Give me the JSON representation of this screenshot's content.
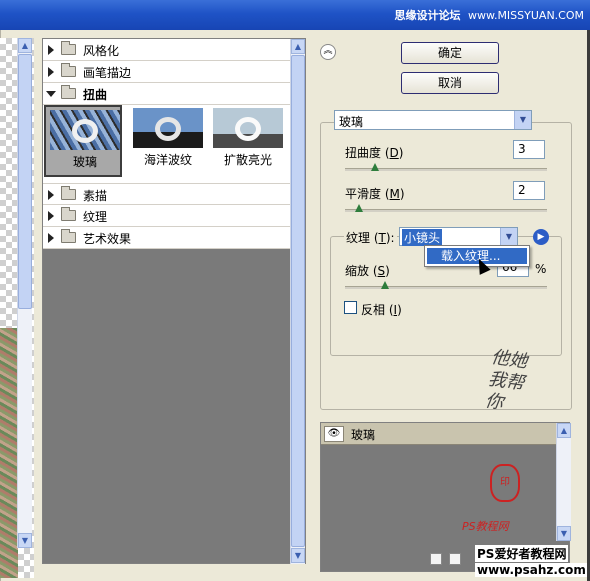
{
  "watermark_top": {
    "cn": "思缘设计论坛",
    "url": "www.MISSYUAN.COM"
  },
  "buttons": {
    "ok": "确定",
    "cancel": "取消",
    "collapse_icon": "double-chevron-up"
  },
  "filter_tree": {
    "categories_top": [
      {
        "label": "风格化",
        "expanded": false
      },
      {
        "label": "画笔描边",
        "expanded": false
      },
      {
        "label": "扭曲",
        "expanded": true
      }
    ],
    "thumbnails": [
      {
        "label": "玻璃",
        "selected": true
      },
      {
        "label": "海洋波纹",
        "selected": false
      },
      {
        "label": "扩散亮光",
        "selected": false
      }
    ],
    "categories_bottom": [
      {
        "label": "素描",
        "expanded": false
      },
      {
        "label": "纹理",
        "expanded": false
      },
      {
        "label": "艺术效果",
        "expanded": false
      }
    ]
  },
  "filter_select": {
    "value": "玻璃"
  },
  "params": {
    "distortion": {
      "label": "扭曲度",
      "key": "D",
      "value": "3",
      "slider_fraction": 0.15
    },
    "smoothness": {
      "label": "平滑度",
      "key": "M",
      "value": "2",
      "slider_fraction": 0.07
    },
    "texture": {
      "label": "纹理",
      "key": "T",
      "value": "小镜头"
    },
    "scaling": {
      "label": "缩放",
      "key": "S",
      "value": "66",
      "unit": "%",
      "slider_fraction": 0.2
    },
    "invert": {
      "label": "反相",
      "key": "I",
      "checked": false
    }
  },
  "texture_menu": {
    "item": "载入纹理..."
  },
  "layers": {
    "items": [
      {
        "name": "玻璃",
        "visible": true
      }
    ]
  },
  "watermarks": {
    "signature": "他她我帮你",
    "site_a": "PS教程网",
    "site_b": "PS爱好者教程网",
    "site_c": "www.psahz.com"
  },
  "colors": {
    "titlebar": "#1f53c6",
    "selection": "#316ac5",
    "panel_bg": "#7a7a7a",
    "dialog_bg": "#ece9d8"
  }
}
